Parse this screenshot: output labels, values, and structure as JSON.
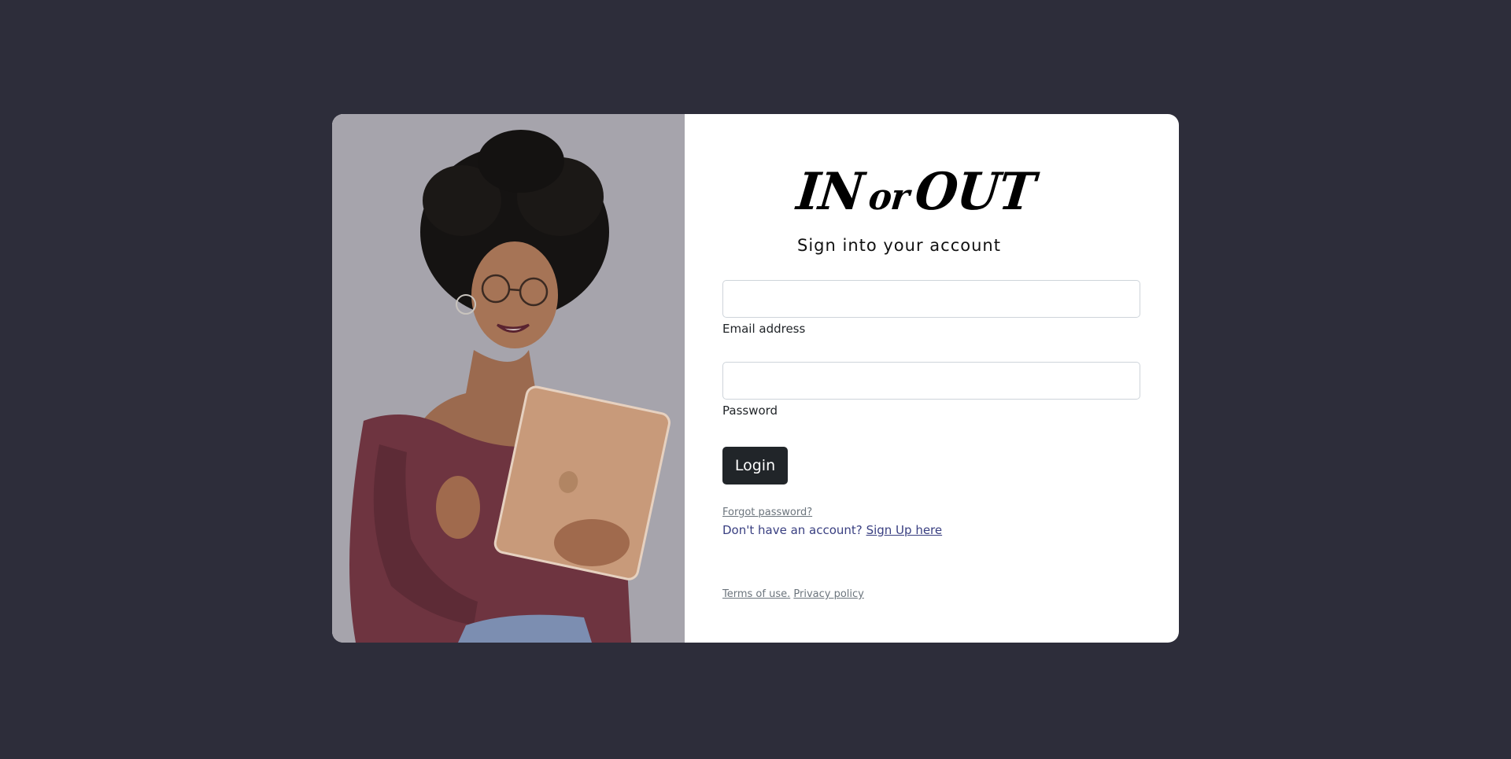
{
  "brand": {
    "word1": "IN",
    "word2": "or",
    "word3": "OUT"
  },
  "subtitle": "Sign into your account",
  "email": {
    "label": "Email address",
    "value": "",
    "placeholder": ""
  },
  "password": {
    "label": "Password",
    "value": "",
    "placeholder": ""
  },
  "login_label": "Login",
  "forgot_label": "Forgot password?",
  "signup": {
    "prompt": "Don't have an account?",
    "link": "Sign Up here"
  },
  "legal": {
    "terms": "Terms of use.",
    "privacy": "Privacy policy"
  },
  "colors": {
    "background": "#2d2d3a",
    "button": "#212529",
    "link": "#393f81",
    "muted": "#6c757d"
  }
}
